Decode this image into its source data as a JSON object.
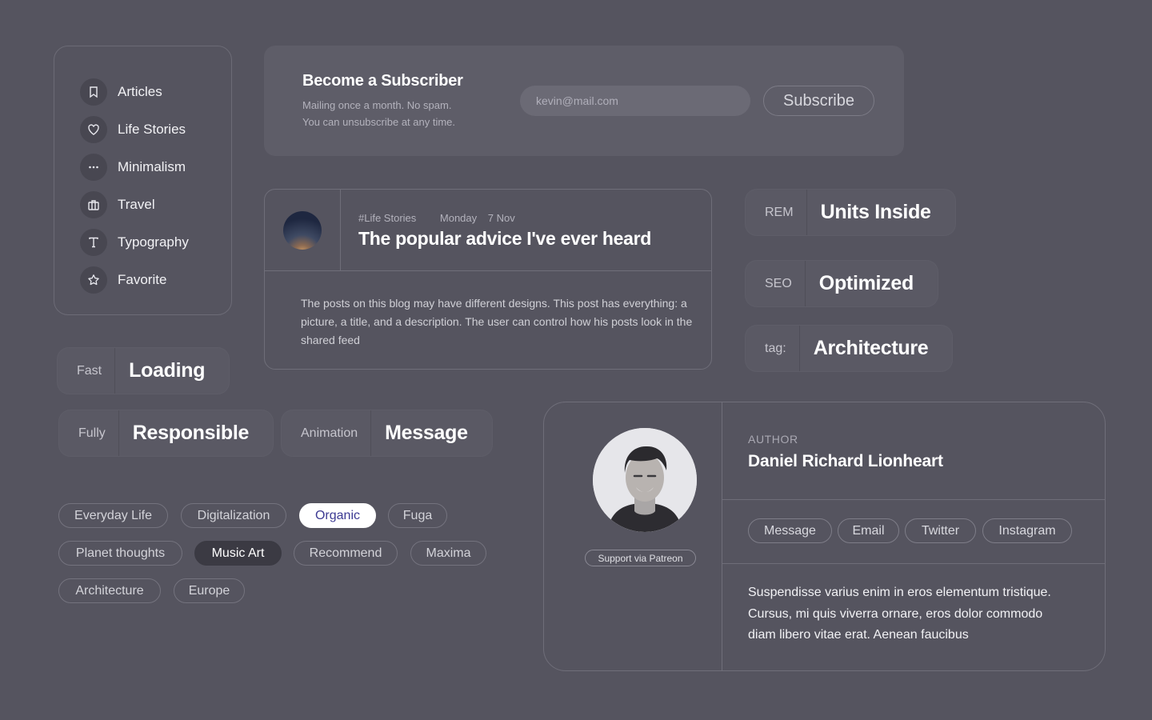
{
  "sidebar": {
    "items": [
      {
        "label": "Articles",
        "icon": "bookmark-icon"
      },
      {
        "label": "Life Stories",
        "icon": "heart-icon"
      },
      {
        "label": "Minimalism",
        "icon": "more-dots-icon"
      },
      {
        "label": "Travel",
        "icon": "briefcase-icon"
      },
      {
        "label": "Typography",
        "icon": "type-icon"
      },
      {
        "label": "Favorite",
        "icon": "star-icon"
      }
    ]
  },
  "subscribe": {
    "title": "Become a Subscriber",
    "desc_line1": "Mailing once a month. No spam.",
    "desc_line2": "You can unsubscribe at any time.",
    "email_placeholder": "kevin@mail.com",
    "button_label": "Subscribe"
  },
  "post": {
    "category": "#Life Stories",
    "day": "Monday",
    "date": "7 Nov",
    "title": "The popular advice I've ever heard",
    "body": "The posts on this blog may have different designs. This post has everything: a picture, a title, and a description. The user can control how his posts look in the shared feed"
  },
  "labels": {
    "rem": {
      "key": "REM",
      "value": "Units Inside"
    },
    "seo": {
      "key": "SEO",
      "value": "Optimized"
    },
    "tag": {
      "key": "tag:",
      "value": "Architecture"
    },
    "fast": {
      "key": "Fast",
      "value": "Loading"
    },
    "fully": {
      "key": "Fully",
      "value": "Responsible"
    },
    "animation": {
      "key": "Animation",
      "value": "Message"
    }
  },
  "tags": [
    "Everyday Life",
    "Digitalization",
    "Organic",
    "Fuga",
    "Planet thoughts",
    "Music Art",
    "Recommend",
    "Maxima",
    "Architecture",
    "Europe"
  ],
  "author": {
    "label": "AUTHOR",
    "name": "Daniel Richard Lionheart",
    "patreon": "Support via Patreon",
    "links": [
      "Message",
      "Email",
      "Twitter",
      "Instagram"
    ],
    "bio": "Suspendisse varius enim in eros elementum tristique. Cursus, mi quis viverra ornare, eros dolor commodo diam libero vitae erat. Aenean faucibus"
  },
  "colors": {
    "background": "#55545f",
    "card": "#5e5d68",
    "tag_active_text": "#3c3a93"
  }
}
